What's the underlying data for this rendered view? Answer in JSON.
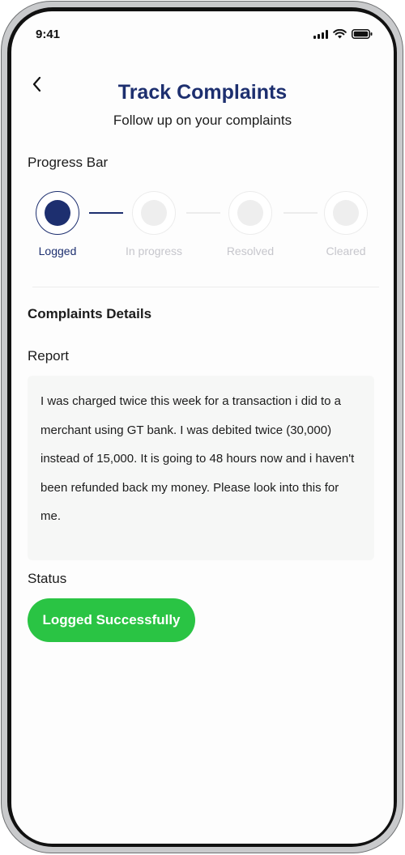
{
  "status_bar": {
    "time": "9:41",
    "icons": [
      "signal-icon",
      "wifi-icon",
      "battery-icon"
    ]
  },
  "header": {
    "back_icon": "chevron-left-icon",
    "title": "Track Complaints",
    "subtitle": "Follow up on your complaints"
  },
  "progress": {
    "heading": "Progress Bar",
    "steps": [
      {
        "label": "Logged",
        "state": "active"
      },
      {
        "label": "In progress",
        "state": "inactive"
      },
      {
        "label": "Resolved",
        "state": "inactive"
      },
      {
        "label": "Cleared",
        "state": "inactive"
      }
    ]
  },
  "details": {
    "heading": "Complaints Details",
    "report_label": "Report",
    "report_text": "I was charged twice this week for a transaction i did to a merchant using GT bank. I was debited twice (30,000) instead of 15,000. It is going to 48 hours now and i haven't been refunded back my money. Please look into this for me.",
    "status_label": "Status",
    "status_value": "Logged Successfully"
  },
  "colors": {
    "primary": "#1d2f6f",
    "success": "#2ac444",
    "inactive": "#c6c6cc",
    "panel": "#f6f7f6"
  }
}
